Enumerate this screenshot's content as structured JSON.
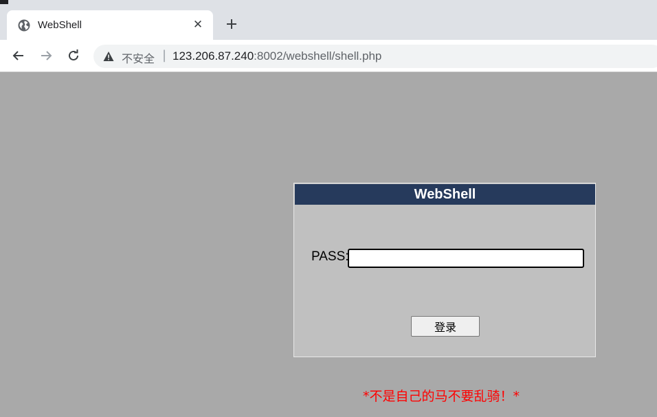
{
  "browser": {
    "tab": {
      "title": "WebShell",
      "icon": "globe-icon",
      "close_glyph": "✕"
    },
    "new_tab_icon": "plus-icon",
    "nav": {
      "back_icon": "back-arrow-icon",
      "forward_icon": "forward-arrow-icon",
      "reload_icon": "reload-icon"
    },
    "address": {
      "security_label": "不安全",
      "separator": "|",
      "url_host": "123.206.87.240",
      "url_rest": ":8002/webshell/shell.php"
    }
  },
  "login": {
    "header": "WebShell",
    "pass_label": "PASS:",
    "pass_value": "",
    "submit_label": "登录"
  },
  "warning": "*不是自己的马不要乱骑！*",
  "colors": {
    "page_bg": "#a9a9a9",
    "panel_bg": "#c0c0c0",
    "header_bg": "#263a5c",
    "warning": "#ff0000"
  }
}
